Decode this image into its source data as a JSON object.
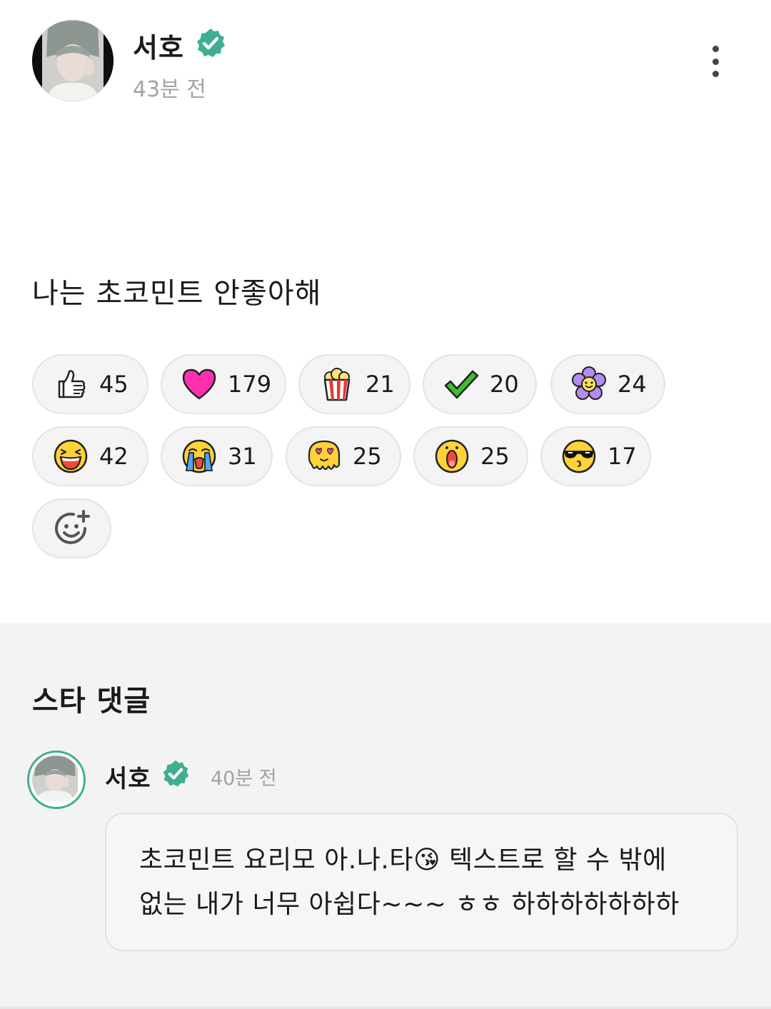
{
  "post": {
    "author": "서호",
    "time": "43분 전",
    "body": "나는 초코민트 안좋아해",
    "verified": true
  },
  "reactions": [
    {
      "icon": "thumbs-up-icon",
      "count": "45"
    },
    {
      "icon": "heart-icon",
      "count": "179"
    },
    {
      "icon": "popcorn-icon",
      "count": "21"
    },
    {
      "icon": "check-icon",
      "count": "20"
    },
    {
      "icon": "flower-icon",
      "count": "24"
    },
    {
      "icon": "laughing-face-icon",
      "count": "42"
    },
    {
      "icon": "crying-face-icon",
      "count": "31"
    },
    {
      "icon": "melting-love-face-icon",
      "count": "25"
    },
    {
      "icon": "surprised-face-icon",
      "count": "25"
    },
    {
      "icon": "sunglasses-face-icon",
      "count": "17"
    }
  ],
  "comments_section": {
    "title": "스타 댓글",
    "comment": {
      "author": "서호",
      "time": "40분 전",
      "line1": "초코민트 요리모 아.나.타😘 텍스트로 할 수 밖에",
      "line2": "없는 내가 너무 아쉽다~~~ ㅎㅎ 하하하하하하하"
    }
  },
  "colors": {
    "verified_badge": "#3fae92",
    "muted_text": "#a3a3a3",
    "chip_bg": "#f4f4f4",
    "section_bg": "#f3f3f3"
  }
}
